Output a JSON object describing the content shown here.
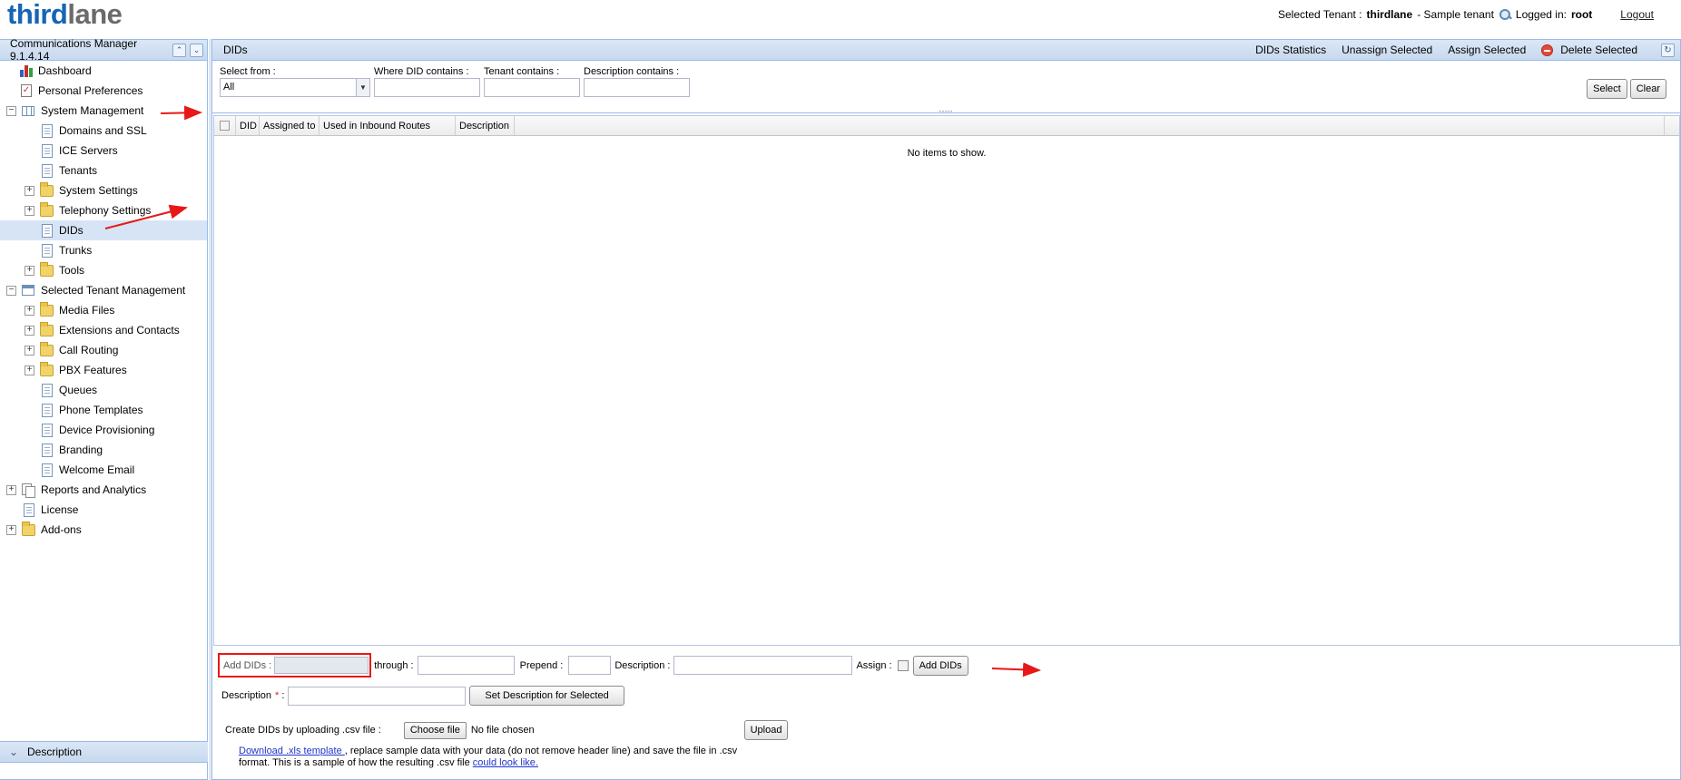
{
  "header": {
    "logo_part1": "third",
    "logo_part2": "lane",
    "selected_tenant_label": "Selected Tenant :",
    "tenant_name": "thirdlane",
    "tenant_suffix": "- Sample tenant",
    "logged_in_label": "Logged in:",
    "user": "root",
    "logout": "Logout"
  },
  "sidebar": {
    "title": "Communications Manager 9.1.4.14",
    "items": [
      {
        "label": "Dashboard"
      },
      {
        "label": "Personal Preferences"
      },
      {
        "label": "System Management"
      },
      {
        "label": "Domains and SSL"
      },
      {
        "label": "ICE Servers"
      },
      {
        "label": "Tenants"
      },
      {
        "label": "System Settings"
      },
      {
        "label": "Telephony Settings"
      },
      {
        "label": "DIDs"
      },
      {
        "label": "Trunks"
      },
      {
        "label": "Tools"
      },
      {
        "label": "Selected Tenant Management"
      },
      {
        "label": "Media Files"
      },
      {
        "label": "Extensions and Contacts"
      },
      {
        "label": "Call Routing"
      },
      {
        "label": "PBX Features"
      },
      {
        "label": "Queues"
      },
      {
        "label": "Phone Templates"
      },
      {
        "label": "Device Provisioning"
      },
      {
        "label": "Branding"
      },
      {
        "label": "Welcome Email"
      },
      {
        "label": "Reports and Analytics"
      },
      {
        "label": "License"
      },
      {
        "label": "Add-ons"
      }
    ],
    "description_panel": "Description"
  },
  "main": {
    "title": "DIDs",
    "toolbar": {
      "stats": "DIDs Statistics",
      "unassign": "Unassign Selected",
      "assign": "Assign Selected",
      "delete": "Delete Selected"
    },
    "filters": {
      "select_from_label": "Select from :",
      "select_from_value": "All",
      "did_label": "Where DID contains  :",
      "tenant_label": "Tenant contains  :",
      "description_label": "Description contains  :",
      "select_btn": "Select",
      "clear_btn": "Clear"
    },
    "grid": {
      "columns": [
        "DID",
        "Assigned to",
        "Used in Inbound Routes",
        "Description"
      ],
      "empty": "No items to show."
    },
    "add": {
      "add_dids_label": "Add DIDs :",
      "through_label": "through :",
      "prepend_label": "Prepend  :",
      "description_label": "Description :",
      "assign_label": "Assign :",
      "add_btn": "Add DIDs",
      "desc2_label": "Description",
      "required_mark": "*",
      "desc2_colon": ":",
      "set_desc_btn": "Set Description for Selected",
      "csv_label": "Create DIDs by uploading .csv file :",
      "choose_file": "Choose file",
      "no_file": "No file chosen",
      "upload_btn": "Upload",
      "note_link1": "Download .xls template ",
      "note_text": ", replace sample data with your data (do not remove header line) and save the file in .csv format.  This is a sample of how the resulting .csv file ",
      "note_link2": "could look like."
    }
  },
  "colors": {
    "panel_border": "#99bbe8",
    "header_bg": "#dae7f6",
    "arrow_red": "#e81818",
    "logo_blue": "#1565b5"
  }
}
